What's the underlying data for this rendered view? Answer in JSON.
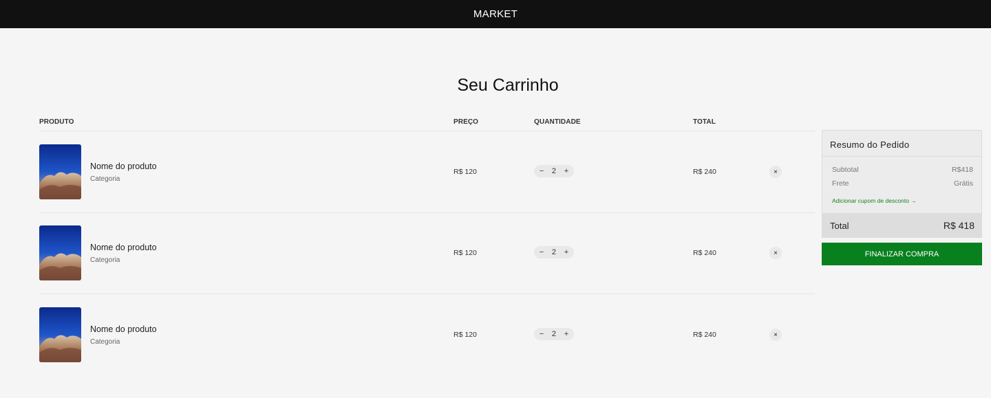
{
  "header": {
    "brand": "MARKET"
  },
  "page": {
    "title": "Seu Carrinho"
  },
  "cart": {
    "columns": {
      "product": "PRODUTO",
      "price": "PREÇO",
      "quantity": "QUANTIDADE",
      "total": "TOTAL"
    },
    "items": [
      {
        "name": "Nome do produto",
        "category": "Categoria",
        "price": "R$ 120",
        "quantity": "2",
        "total": "R$ 240",
        "minus": "−",
        "plus": "+",
        "remove": "×"
      },
      {
        "name": "Nome do produto",
        "category": "Categoria",
        "price": "R$ 120",
        "quantity": "2",
        "total": "R$ 240",
        "minus": "−",
        "plus": "+",
        "remove": "×"
      },
      {
        "name": "Nome do produto",
        "category": "Categoria",
        "price": "R$ 120",
        "quantity": "2",
        "total": "R$ 240",
        "minus": "−",
        "plus": "+",
        "remove": "×"
      }
    ]
  },
  "summary": {
    "title": "Resumo do Pedido",
    "subtotal_label": "Subtotal",
    "subtotal_value": "R$418",
    "shipping_label": "Frete",
    "shipping_value": "Grátis",
    "coupon_link": "Adicionar cupom de desconto →",
    "total_label": "Total",
    "total_value": "R$ 418",
    "checkout_button": "FINALIZAR COMPRA"
  },
  "colors": {
    "topbar": "#111111",
    "accent": "#08801e",
    "background": "#f5f5f5"
  }
}
